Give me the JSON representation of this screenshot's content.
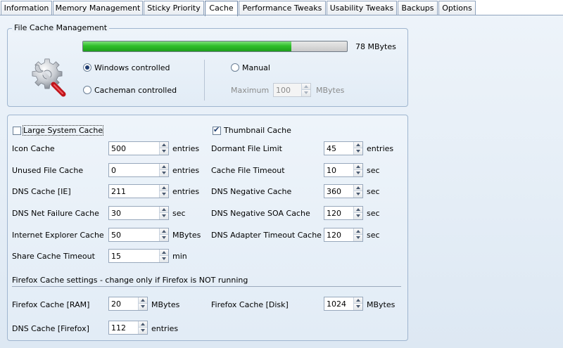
{
  "tabs": [
    {
      "label": "Information"
    },
    {
      "label": "Memory Management"
    },
    {
      "label": "Sticky Priority"
    },
    {
      "label": "Cache"
    },
    {
      "label": "Performance Tweaks"
    },
    {
      "label": "Usability Tweaks"
    },
    {
      "label": "Backups"
    },
    {
      "label": "Options"
    }
  ],
  "active_tab": "Cache",
  "file_cache": {
    "title": "File Cache Management",
    "usage_text": "78 MBytes",
    "usage_fraction": 0.79,
    "windows_controlled": "Windows controlled",
    "cacheman_controlled": "Cacheman controlled",
    "manual": "Manual",
    "maximum_label": "Maximum",
    "maximum_value": "100",
    "maximum_unit": "MBytes",
    "icon": "gear-wrench-icon"
  },
  "settings": {
    "large_system_cache": "Large System Cache",
    "thumbnail_cache": "Thumbnail Cache",
    "icon_cache": {
      "label": "Icon Cache",
      "value": "500",
      "unit": "entries"
    },
    "unused_file_cache": {
      "label": "Unused File Cache",
      "value": "0",
      "unit": "entries"
    },
    "dns_cache_ie": {
      "label": "DNS Cache [IE]",
      "value": "211",
      "unit": "entries"
    },
    "dns_net_failure": {
      "label": "DNS Net Failure Cache",
      "value": "30",
      "unit": "sec"
    },
    "ie_cache": {
      "label": "Internet Explorer Cache",
      "value": "50",
      "unit": "MBytes"
    },
    "share_cache_timeout": {
      "label": "Share Cache Timeout",
      "value": "15",
      "unit": "min"
    },
    "dormant_file_limit": {
      "label": "Dormant File Limit",
      "value": "45",
      "unit": "entries"
    },
    "cache_file_timeout": {
      "label": "Cache File Timeout",
      "value": "10",
      "unit": "sec"
    },
    "dns_negative_cache": {
      "label": "DNS Negative Cache",
      "value": "360",
      "unit": "sec"
    },
    "dns_negative_soa": {
      "label": "DNS Negative SOA Cache",
      "value": "120",
      "unit": "sec"
    },
    "dns_adapter_timeout": {
      "label": "DNS Adapter Timeout Cache",
      "value": "120",
      "unit": "sec"
    }
  },
  "firefox": {
    "heading": "Firefox Cache settings - change only if Firefox is NOT running",
    "ram": {
      "label": "Firefox Cache [RAM]",
      "value": "20",
      "unit": "MBytes"
    },
    "disk": {
      "label": "Firefox Cache [Disk]",
      "value": "1024",
      "unit": "MBytes"
    },
    "dns": {
      "label": "DNS Cache [Firefox]",
      "value": "112",
      "unit": "entries"
    }
  }
}
